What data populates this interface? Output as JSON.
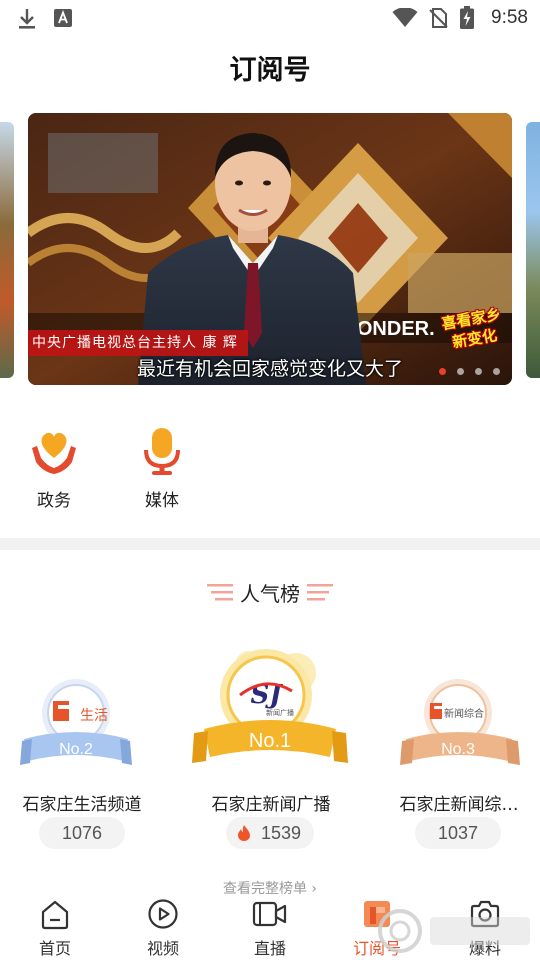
{
  "status_bar": {
    "time": "9:58"
  },
  "header": {
    "title": "订阅号"
  },
  "banner": {
    "host_tag": "中央广播电视总台主持人  康 辉",
    "caption": "最近有机会回家感觉变化又大了",
    "slogan_line1": "喜看家乡",
    "slogan_line2": "新变化",
    "backdrop_text": "WONDER.",
    "slides": 4,
    "active_slide": 1
  },
  "categories": [
    {
      "label": "政务",
      "icon": "heart-hands-icon"
    },
    {
      "label": "媒体",
      "icon": "microphone-icon"
    }
  ],
  "ranking": {
    "title": "人气榜",
    "view_all": "查看完整榜单 ›",
    "entries": [
      {
        "rank_label": "No.1",
        "name": "石家庄新闻广播",
        "count": "1539",
        "logo_text": "SJ",
        "logo_sub": "新闻广播",
        "hot": true
      },
      {
        "rank_label": "No.2",
        "name": "石家庄生活频道",
        "count": "1076",
        "logo_text": "生活",
        "hot": false
      },
      {
        "rank_label": "No.3",
        "name": "石家庄新闻综…",
        "count": "1037",
        "logo_text": "新闻综合",
        "hot": false
      }
    ]
  },
  "bottom_nav": [
    {
      "label": "首页",
      "icon": "home-icon",
      "active": false
    },
    {
      "label": "视频",
      "icon": "play-circle-icon",
      "active": false
    },
    {
      "label": "直播",
      "icon": "video-camera-icon",
      "active": false
    },
    {
      "label": "订阅号",
      "icon": "subscription-icon",
      "active": true
    },
    {
      "label": "爆料",
      "icon": "camera-icon",
      "active": false
    }
  ],
  "colors": {
    "accent": "#e8542a",
    "gold": "#f5b52a",
    "silver_blue": "#8fb6ec",
    "bronze": "#e9a576",
    "heart": "#f5a623",
    "hands": "#e34a2e"
  }
}
